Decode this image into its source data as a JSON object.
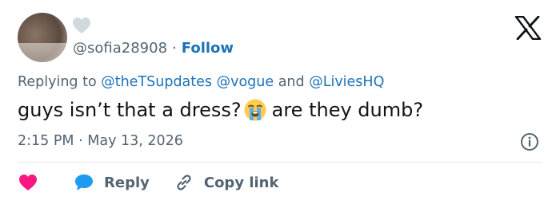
{
  "tweet": {
    "handle": "@sofia28908",
    "separator": "·",
    "follow_label": "Follow",
    "replying_prefix": "Replying to ",
    "mentions": [
      "@theTSupdates",
      "@vogue",
      "@LiviesHQ"
    ],
    "mention_joiners": [
      " ",
      " and "
    ],
    "text_before_emoji": "guys isn’t that a dress?",
    "emoji": "loudly-crying-face-emoji",
    "text_after_emoji": "are they dumb?",
    "time": "2:15 PM",
    "date": "May 13, 2026"
  },
  "actions": {
    "reply_label": "Reply",
    "copy_link_label": "Copy link"
  },
  "colors": {
    "link_blue": "#1d72b8",
    "secondary_text": "#536471",
    "like_red": "#f91880",
    "reply_blue": "#1d9bf0",
    "divider": "#e3e8ec"
  },
  "icons": [
    "heart-icon",
    "x-logo-icon",
    "info-icon",
    "like-heart-icon",
    "reply-bubble-icon",
    "link-icon"
  ]
}
